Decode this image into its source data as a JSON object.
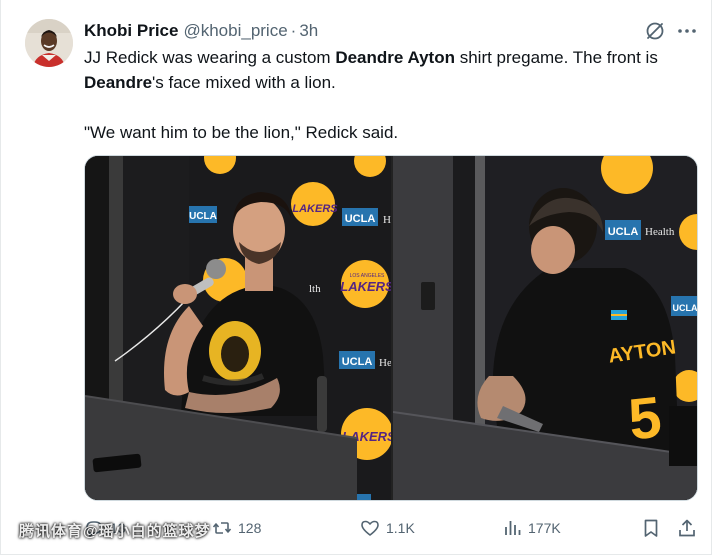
{
  "author": {
    "name": "Khobi Price",
    "handle": "@khobi_price",
    "separator": "·",
    "time": "3h"
  },
  "tweet": {
    "line1": {
      "part1": "JJ Redick was wearing a custom ",
      "bold1": "Deandre Ayton",
      "part2": " shirt pregame. The front is"
    },
    "line2": {
      "bold1": "Deandre",
      "part1": "'s face mixed with a lion."
    },
    "quote": "\"We want him to be the lion,\" Redick said."
  },
  "media": {
    "left_photo": {
      "backdrop_text_ucla": "UCLA",
      "backdrop_text_health": "He",
      "backdrop_text_lakers": "LAKERS",
      "backdrop_text_los_angeles": "LOS ANGELES",
      "backdrop_text_alth": "lth"
    },
    "right_photo": {
      "backdrop_text_ucla": "UCLA",
      "backdrop_text_health": "Health",
      "shirt_text": "AYTON",
      "shirt_number": "5"
    }
  },
  "actions": {
    "replies": "13",
    "reposts": "128",
    "likes": "1.1K",
    "views": "177K"
  },
  "watermark": "腾讯体育@瑶小白的篮球梦",
  "icons": {
    "grok": "grok-icon",
    "more": "more-icon",
    "reply": "reply-icon",
    "repost": "repost-icon",
    "like": "like-icon",
    "views": "views-icon",
    "bookmark": "bookmark-icon",
    "share": "share-icon"
  },
  "colors": {
    "text": "#0f1419",
    "secondary": "#536471",
    "lakers_purple": "#552583",
    "lakers_gold": "#fdb927",
    "ucla_blue": "#2774ae"
  }
}
